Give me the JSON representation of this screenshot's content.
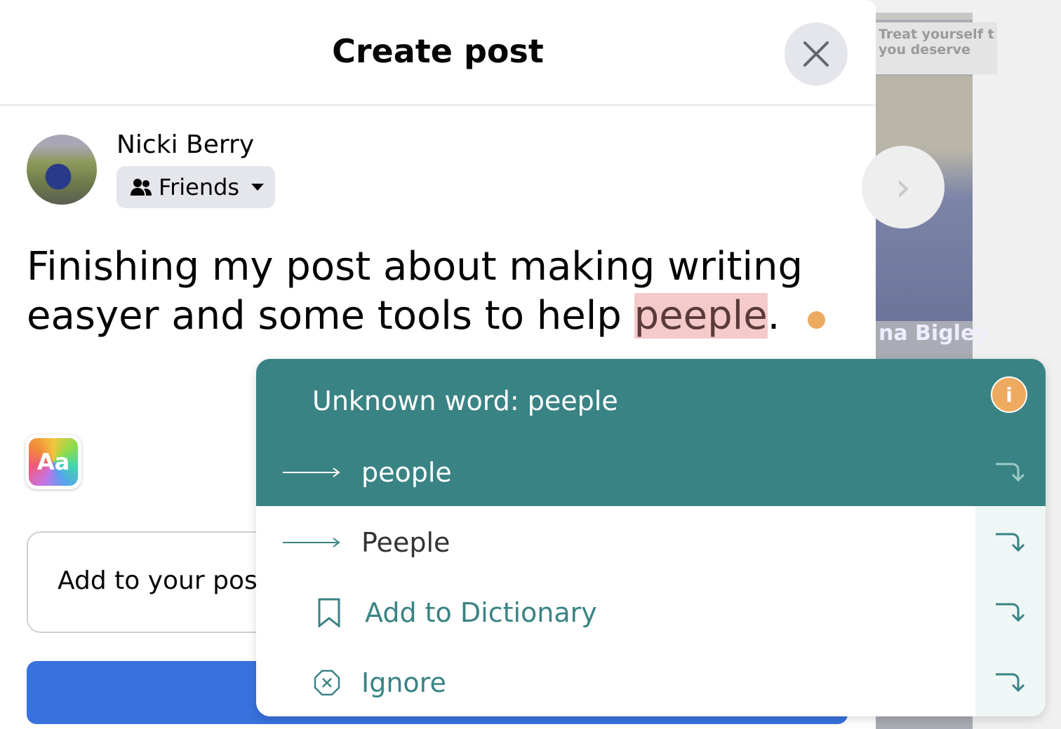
{
  "background_story": {
    "ad_text": "Treat yourself t\nyou deserve",
    "name": "na Bigley"
  },
  "dialog": {
    "title": "Create post",
    "user_name": "Nicki Berry",
    "audience": "Friends",
    "post_text_before": "Finishing my post about making writing\neasyer and some tools to help ",
    "post_text_flagged": "peeple",
    "post_text_after": ".",
    "add_to_post": "Add to your post"
  },
  "spell_popup": {
    "title": "Unknown word: peeple",
    "suggestions": [
      "people",
      "Peeple"
    ],
    "add_to_dictionary": "Add to Dictionary",
    "ignore": "Ignore",
    "accent": "#3a8384",
    "info_color": "#eeaa5e"
  }
}
